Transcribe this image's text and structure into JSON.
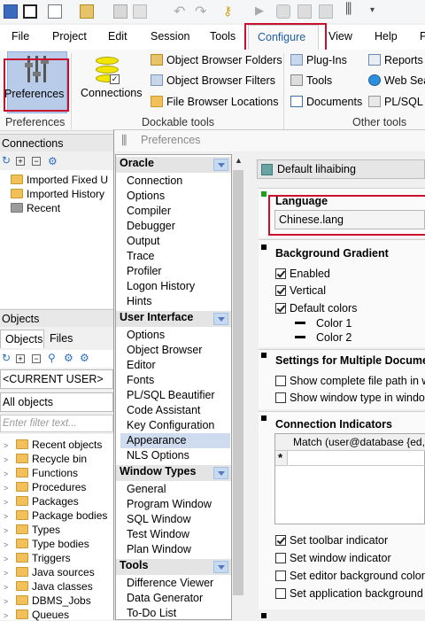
{
  "menu": {
    "file": "File",
    "project": "Project",
    "edit": "Edit",
    "session": "Session",
    "tools": "Tools",
    "configure": "Configure",
    "view": "View",
    "help": "Help",
    "more": "P"
  },
  "ribbon": {
    "preferences": "Preferences",
    "connections": "Connections",
    "object_browser_folders": "Object Browser Folders",
    "object_browser_filters": "Object Browser Filters",
    "file_browser_locations": "File Browser Locations",
    "plugins": "Plug-Ins",
    "tools": "Tools",
    "documents": "Documents",
    "reports": "Reports",
    "web_search": "Web Sea",
    "plsql": "PL/SQL E",
    "group_preferences": "Preferences",
    "group_dockable": "Dockable tools",
    "group_other": "Other tools"
  },
  "connections_pane": {
    "title": "Connections",
    "items": [
      "Imported Fixed U",
      "Imported History",
      "Recent"
    ]
  },
  "objects_pane": {
    "title": "Objects",
    "tab_objects": "Objects",
    "tab_files": "Files",
    "user_select": "<CURRENT USER>",
    "scope_select": "All objects",
    "filter_placeholder": "Enter filter text...",
    "items": [
      "Recent objects",
      "Recycle bin",
      "Functions",
      "Procedures",
      "Packages",
      "Package bodies",
      "Types",
      "Type bodies",
      "Triggers",
      "Java sources",
      "Java classes",
      "DBMS_Jobs",
      "Queues"
    ]
  },
  "dialog": {
    "title": "Preferences",
    "profile": "Default lihaibing",
    "categories": {
      "oracle": "Oracle",
      "oracle_items": [
        "Connection",
        "Options",
        "Compiler",
        "Debugger",
        "Output",
        "Trace",
        "Profiler",
        "Logon History",
        "Hints"
      ],
      "ui": "User Interface",
      "ui_items": [
        "Options",
        "Object Browser",
        "Editor",
        "Fonts",
        "PL/SQL Beautifier",
        "Code Assistant",
        "Key Configuration",
        "Appearance",
        "NLS Options"
      ],
      "wt": "Window Types",
      "wt_items": [
        "General",
        "Program Window",
        "SQL Window",
        "Test Window",
        "Plan Window"
      ],
      "tools": "Tools",
      "tools_items": [
        "Difference Viewer",
        "Data Generator",
        "To-Do List"
      ]
    },
    "language": {
      "label": "Language",
      "value": "Chinese.lang"
    },
    "background_gradient": {
      "title": "Background Gradient",
      "enabled": "Enabled",
      "vertical": "Vertical",
      "default_colors": "Default colors",
      "color1": "Color 1",
      "color2": "Color 2"
    },
    "multi_doc": {
      "title": "Settings for Multiple Documer",
      "complete_path": "Show complete file path in w",
      "window_type": "Show window type in window"
    },
    "conn_ind": {
      "title": "Connection Indicators",
      "col_match": "Match (user@database {ed,w",
      "new_row": "*",
      "toolbar": "Set toolbar indicator",
      "window": "Set window indicator",
      "editor_bg": "Set editor background color",
      "app_bg": "Set application background c"
    }
  }
}
